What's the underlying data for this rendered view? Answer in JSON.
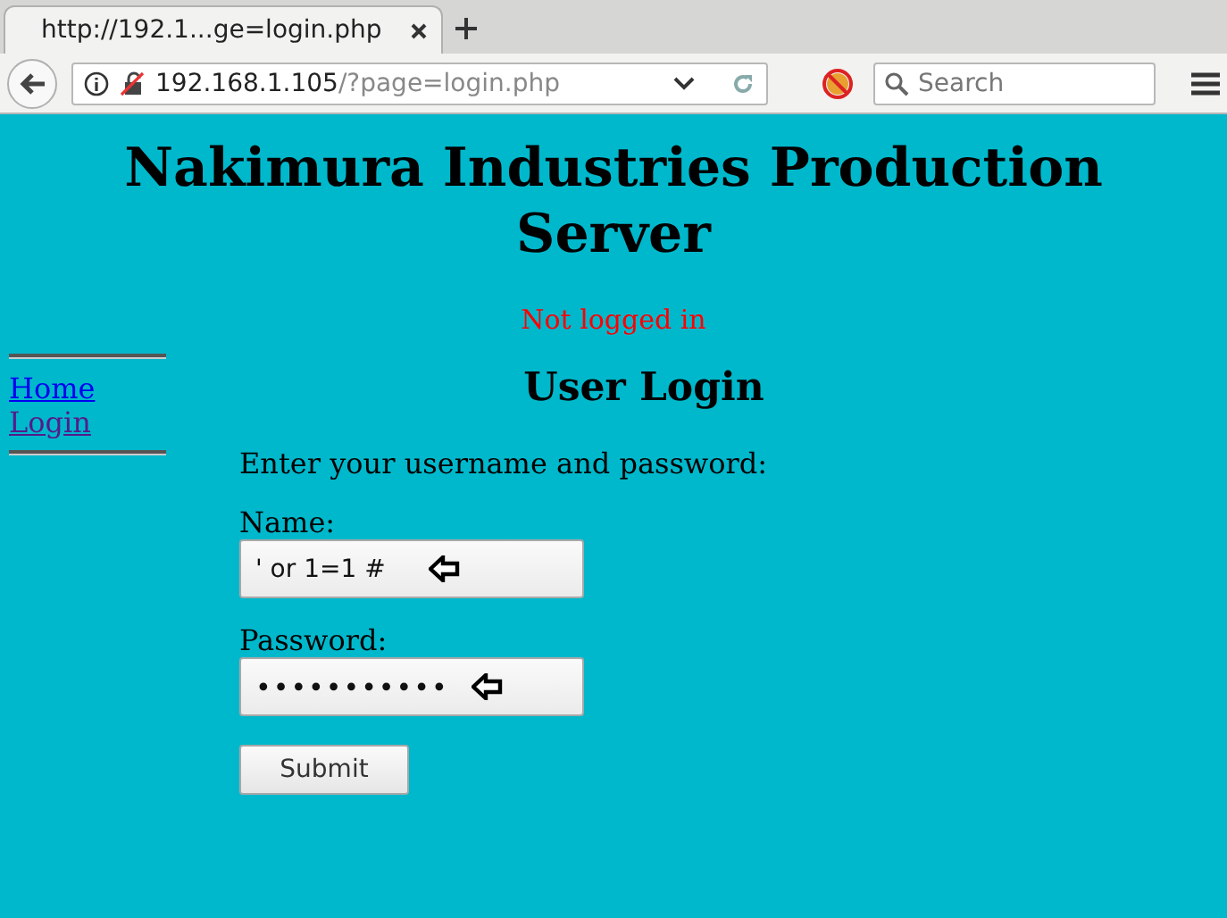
{
  "browser": {
    "tab": {
      "title": "http://192.1...ge=login.php",
      "selected": true
    },
    "address": {
      "host": "192.168.1.105",
      "path": "/?page=login.php"
    },
    "search": {
      "placeholder": "Search"
    }
  },
  "page": {
    "title": "Nakimura Industries Production Server",
    "status": "Not logged in",
    "nav": [
      {
        "label": "Home",
        "visited": false
      },
      {
        "label": "Login",
        "visited": true
      }
    ],
    "heading": "User Login",
    "intro": "Enter your username and password:",
    "fields": [
      {
        "label": "Name:",
        "value": "' or 1=1 #",
        "kind": "text"
      },
      {
        "label": "Password:",
        "value": "•••••••••••",
        "kind": "password"
      }
    ],
    "submit": "Submit"
  }
}
